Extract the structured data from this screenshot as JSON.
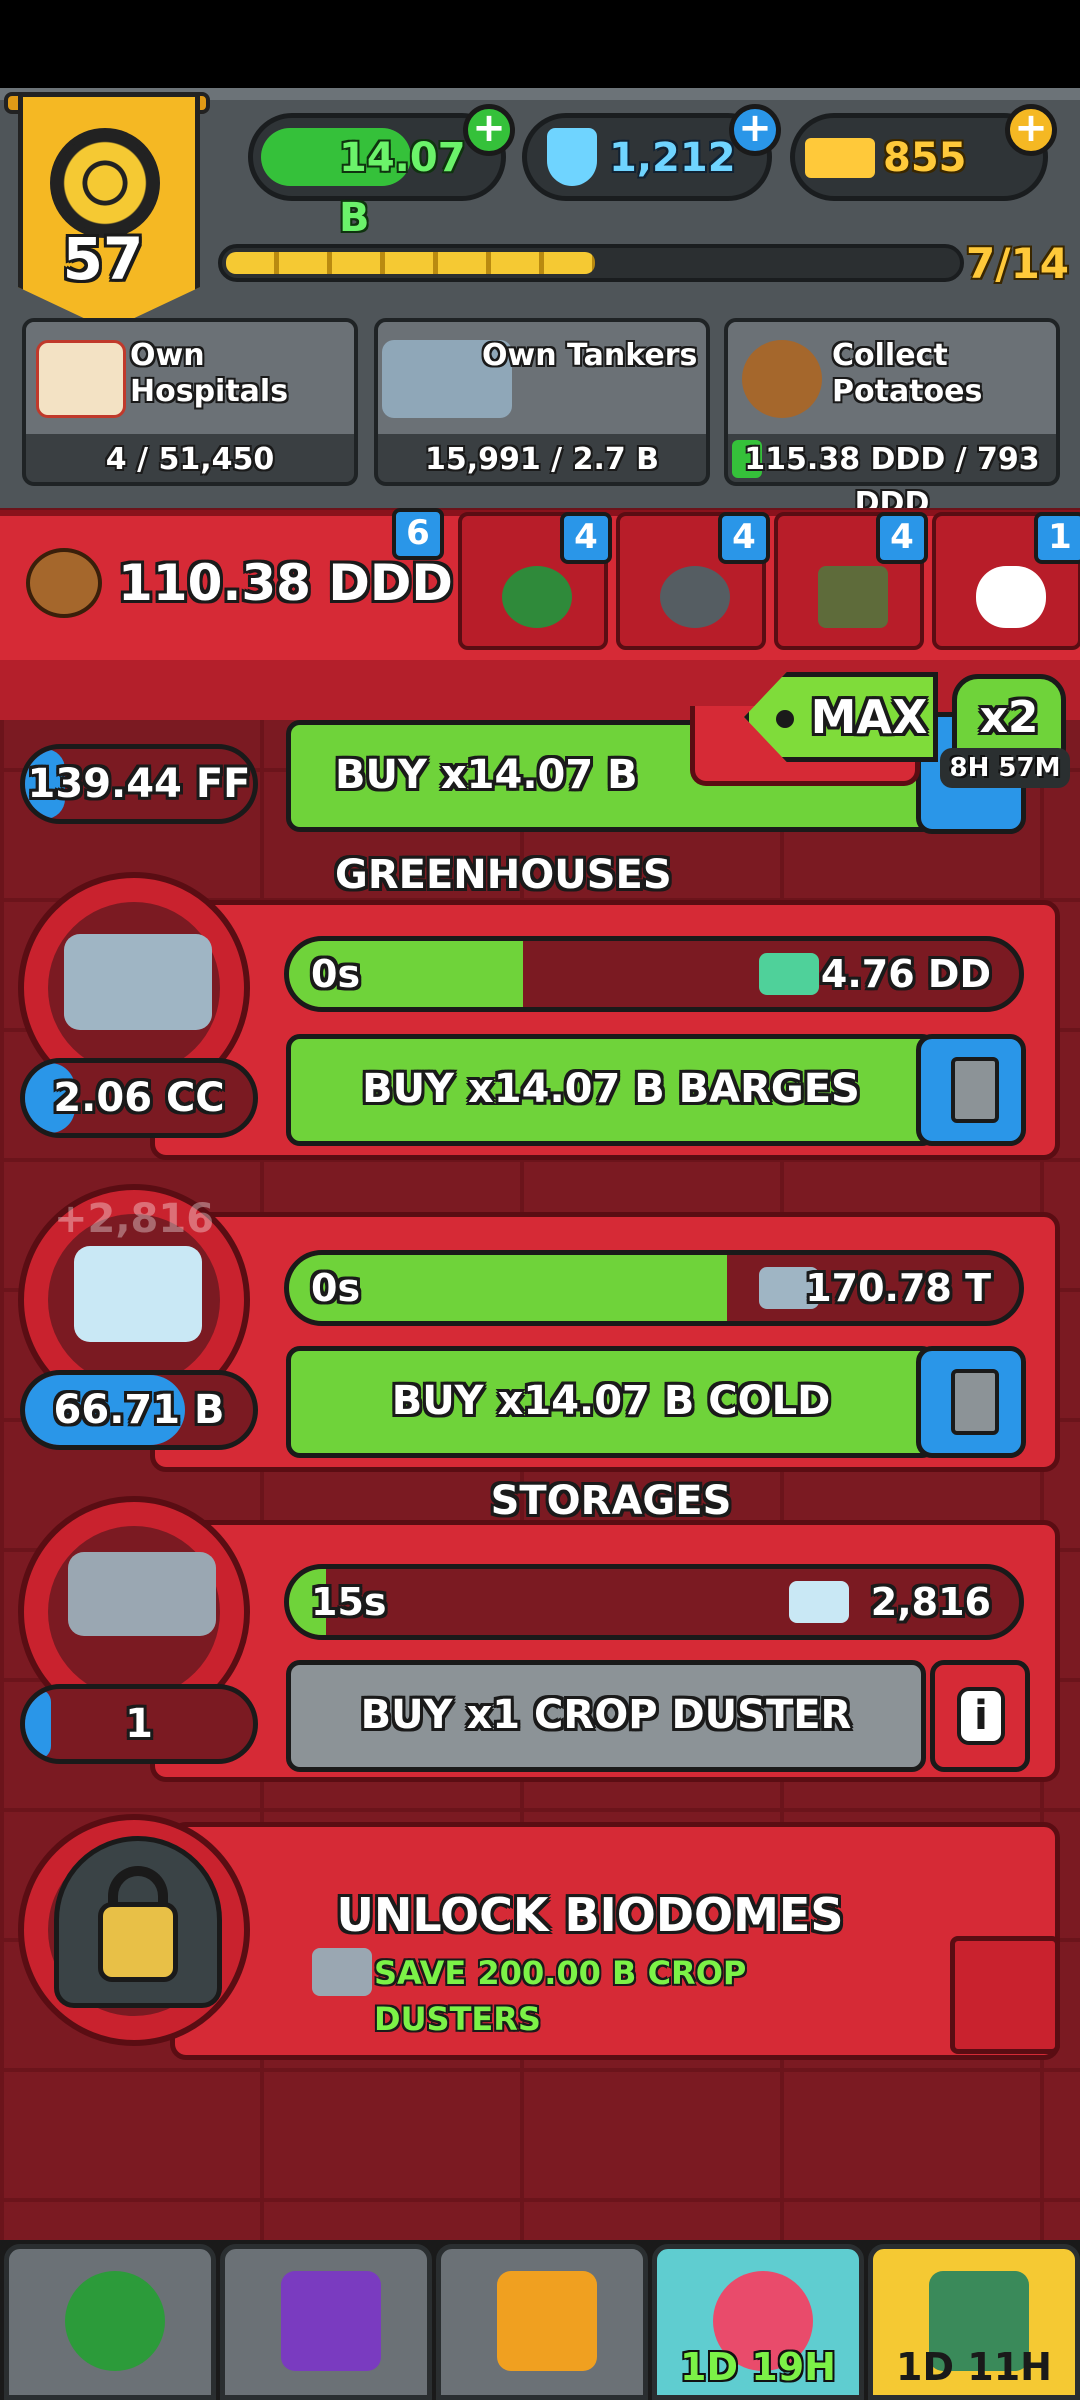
{
  "hud": {
    "level": "57",
    "cash": "14.07 B",
    "science": "1,212",
    "gold": "855",
    "xp_progress_text": "7/14",
    "xp_fraction": 0.5,
    "quests": [
      {
        "title": "Own\nHospitals",
        "progress": "4 / 51,450",
        "icon": "hospital-icon"
      },
      {
        "title": "Own Tankers",
        "progress": "15,991 / 2.7 B",
        "icon": "tanker-icon"
      },
      {
        "title": "Collect\nPotatoes",
        "progress": "115.38 DDD / 793 DDD",
        "icon": "potato-icon"
      }
    ]
  },
  "currency": {
    "potatoes": "110.38 DDD",
    "badges": [
      "6",
      "4",
      "4",
      "4",
      "1"
    ],
    "max_label": "MAX",
    "multiplier_label": "x2",
    "multiplier_timer": "8H 57M"
  },
  "generators": [
    {
      "name": "greenhouses",
      "count": "139.44 FF",
      "buy_label": "BUY x14.07 B GREENHOUSES"
    },
    {
      "name": "barges",
      "count": "2.06 CC",
      "timer": "0s",
      "timer_fraction": 0.32,
      "output": "4.76 DD",
      "buy_label": "BUY x14.07 B BARGES"
    },
    {
      "name": "cold-storages",
      "count": "66.71 B",
      "timer": "0s",
      "timer_fraction": 0.6,
      "output": "170.78 T",
      "buy_label": "BUY x14.07 B COLD STORAGES",
      "floating_gain": "+2,816"
    },
    {
      "name": "crop-duster",
      "count": "1",
      "timer": "15s",
      "timer_fraction": 0.05,
      "output": "2,816",
      "buy_label": "BUY x1 CROP DUSTER"
    }
  ],
  "unlock": {
    "title": "UNLOCK BIODOMES",
    "requirement": "SAVE 200.00 B CROP DUSTERS"
  },
  "nav": {
    "tabs": [
      {
        "name": "missions",
        "icon": "flag-icon",
        "timer": ""
      },
      {
        "name": "cards",
        "icon": "cards-icon",
        "timer": ""
      },
      {
        "name": "research",
        "icon": "folder-icon",
        "timer": ""
      },
      {
        "name": "event",
        "icon": "ticket-icon",
        "timer": "1D 19H"
      },
      {
        "name": "shop",
        "icon": "chest-icon",
        "timer": "1D 11H"
      }
    ]
  },
  "colors": {
    "panel_red": "#d62a36",
    "wall_red": "#7b1a22",
    "button_green": "#6fd33a",
    "accent_blue": "#2a96e8",
    "gold": "#f5c933"
  }
}
